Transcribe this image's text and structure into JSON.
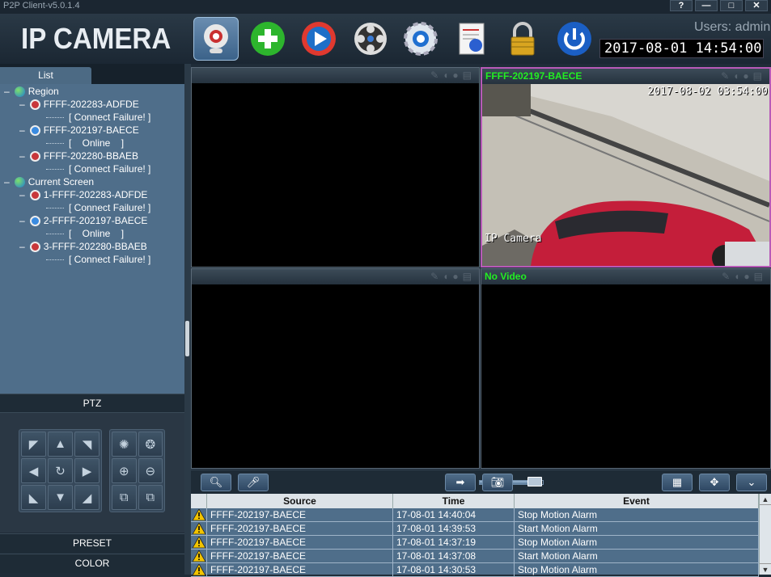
{
  "window": {
    "title": "P2P Client-v5.0.1.4",
    "buttons": [
      "?",
      "—",
      "□",
      "✕"
    ]
  },
  "header": {
    "logo": "IP CAMERA",
    "users": "Users: admin",
    "clock": "2017-08-01 14:54:00",
    "toolbar": [
      "camera-view",
      "add-device",
      "playback",
      "video-reel",
      "settings",
      "log-search",
      "lock",
      "power"
    ]
  },
  "sidebar": {
    "tab": "List",
    "tree": [
      {
        "type": "group",
        "label": "Region"
      },
      {
        "type": "device",
        "label": "FFFF-202283-ADFDE",
        "status": "[ Connect Failure! ]"
      },
      {
        "type": "device",
        "label": "FFFF-202197-BAECE",
        "status": "[    Online    ]"
      },
      {
        "type": "device",
        "label": "FFFF-202280-BBAEB",
        "status": "[ Connect Failure! ]"
      },
      {
        "type": "group",
        "label": "Current Screen"
      },
      {
        "type": "device",
        "label": "1-FFFF-202283-ADFDE",
        "status": "[ Connect Failure! ]"
      },
      {
        "type": "device",
        "label": "2-FFFF-202197-BAECE",
        "status": "[    Online    ]"
      },
      {
        "type": "device",
        "label": "3-FFFF-202280-BBAEB",
        "status": "[ Connect Failure! ]"
      }
    ],
    "ptz": "PTZ",
    "preset": "PRESET",
    "color": "COLOR"
  },
  "videos": [
    {
      "label": "",
      "stamp": "",
      "caption": ""
    },
    {
      "label": "FFFF-202197-BAECE",
      "stamp": "2017-08-02 03:54:00",
      "caption": "IP Camera"
    },
    {
      "label": "",
      "stamp": "",
      "caption": ""
    },
    {
      "label": "No Video",
      "stamp": "",
      "caption": ""
    }
  ],
  "volume": 0.85,
  "log": {
    "columns": [
      "Source",
      "Time",
      "Event"
    ],
    "rows": [
      {
        "source": "FFFF-202197-BAECE",
        "time": "17-08-01 14:40:04",
        "event": "Stop Motion Alarm"
      },
      {
        "source": "FFFF-202197-BAECE",
        "time": "17-08-01 14:39:53",
        "event": "Start Motion Alarm"
      },
      {
        "source": "FFFF-202197-BAECE",
        "time": "17-08-01 14:37:19",
        "event": "Stop Motion Alarm"
      },
      {
        "source": "FFFF-202197-BAECE",
        "time": "17-08-01 14:37:08",
        "event": "Start Motion Alarm"
      },
      {
        "source": "FFFF-202197-BAECE",
        "time": "17-08-01 14:30:53",
        "event": "Stop Motion Alarm"
      }
    ]
  }
}
